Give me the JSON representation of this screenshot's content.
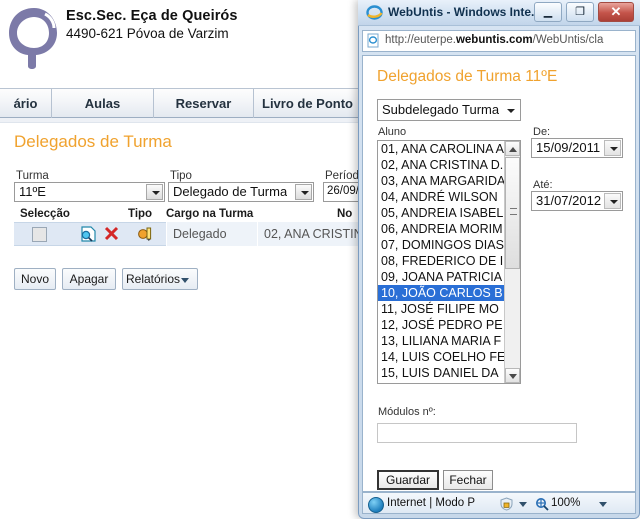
{
  "main": {
    "school": {
      "name": "Esc.Sec. Eça de Queirós",
      "address": "4490-621 Póvoa de Varzim",
      "logo_icon": "q-logo-icon"
    },
    "tabs": [
      {
        "label": "ário"
      },
      {
        "label": "Aulas"
      },
      {
        "label": "Reservar"
      },
      {
        "label": "Livro de Ponto"
      }
    ],
    "page_title": "Delegados de Turma",
    "filters": {
      "turma_label": "Turma",
      "turma_value": "11ºE",
      "tipo_label": "Tipo",
      "tipo_value": "Delegado de Turma",
      "periodo_label": "Período",
      "periodo_value": "26/09/"
    },
    "grid": {
      "headers": {
        "seleccao": "Selecção",
        "tipo": "Tipo",
        "cargo": "Cargo na Turma",
        "nome": "No"
      },
      "row": {
        "cargo": "Delegado",
        "nome": "02, ANA CRISTIN",
        "detail_icon": "magnifier-page-icon",
        "delete_icon": "red-x-icon",
        "edit_icon": "pencil-edit-icon",
        "checkbox_icon": "checkbox-unchecked-icon"
      }
    },
    "buttons": {
      "novo": "Novo",
      "apagar": "Apagar",
      "relatorios": "Relatórios",
      "relatorios_icon": "chevron-down-icon"
    }
  },
  "popup": {
    "window_title": "WebUntis - Windows Inte...",
    "ie_icon": "internet-explorer-icon",
    "window_controls": {
      "minimize": "—",
      "maximize": "❐",
      "close": "✕"
    },
    "address": {
      "protocol_host_pre": "http://euterpe.",
      "host_bold": "webuntis.com",
      "path": "/WebUntis/cla",
      "icon": "page-icon"
    },
    "title": "Delegados de Turma 11ºE",
    "role_select": {
      "value": "Subdelegado Turma",
      "arrow_icon": "chevron-down-icon"
    },
    "aluno_label": "Aluno",
    "students": [
      {
        "text": "01, ANA CAROLINA A",
        "selected": false
      },
      {
        "text": "02, ANA CRISTINA D.",
        "selected": false
      },
      {
        "text": "03, ANA MARGARIDA",
        "selected": false
      },
      {
        "text": "04, ANDRÉ WILSON",
        "selected": false
      },
      {
        "text": "05, ANDREIA ISABEL",
        "selected": false
      },
      {
        "text": "06, ANDREIA MORIM",
        "selected": false
      },
      {
        "text": "07, DOMINGOS DIAS",
        "selected": false
      },
      {
        "text": "08, FREDERICO DE I",
        "selected": false
      },
      {
        "text": "09, JOANA PATRICIA",
        "selected": false
      },
      {
        "text": "10, JOÃO CARLOS B",
        "selected": true
      },
      {
        "text": "11, JOSÉ FILIPE MO",
        "selected": false
      },
      {
        "text": "12, JOSÉ PEDRO PE",
        "selected": false
      },
      {
        "text": "13, LILIANA MARIA F",
        "selected": false
      },
      {
        "text": "14, LUIS COELHO FE",
        "selected": false
      },
      {
        "text": "15, LUIS DANIEL DA",
        "selected": false
      }
    ],
    "date_from": {
      "label": "De:",
      "value": "15/09/2011",
      "arrow_icon": "chevron-down-icon"
    },
    "date_to": {
      "label": "Até:",
      "value": "31/07/2012",
      "arrow_icon": "chevron-down-icon"
    },
    "modules": {
      "label": "Módulos nº:",
      "value": "",
      "placeholder": ""
    },
    "buttons": {
      "save": "Guardar",
      "close": "Fechar"
    },
    "statusbar": {
      "zone": "Internet | Modo P",
      "zoom": "100%",
      "globe_icon": "internet-zone-icon",
      "lock_icon": "protected-mode-icon",
      "zoom_icon": "magnifier-zoom-icon"
    }
  }
}
